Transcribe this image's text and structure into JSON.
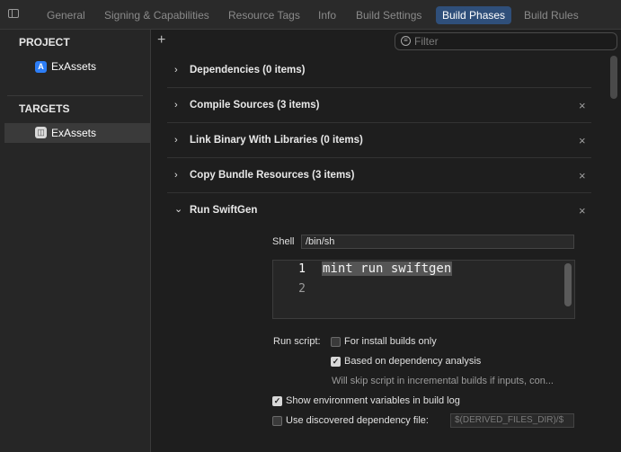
{
  "tabs": [
    {
      "label": "General"
    },
    {
      "label": "Signing & Capabilities"
    },
    {
      "label": "Resource Tags"
    },
    {
      "label": "Info"
    },
    {
      "label": "Build Settings"
    },
    {
      "label": "Build Phases",
      "active": true
    },
    {
      "label": "Build Rules"
    }
  ],
  "sidebar": {
    "project_title": "PROJECT",
    "project_item": "ExAssets",
    "targets_title": "TARGETS",
    "target_item": "ExAssets"
  },
  "toolbar": {
    "add_symbol": "+",
    "filter_placeholder": "Filter"
  },
  "phases": [
    {
      "title": "Dependencies (0 items)",
      "removable": false
    },
    {
      "title": "Compile Sources (3 items)",
      "removable": true
    },
    {
      "title": "Link Binary With Libraries (0 items)",
      "removable": true
    },
    {
      "title": "Copy Bundle Resources (3 items)",
      "removable": true
    },
    {
      "title": "Run SwiftGen",
      "removable": true,
      "expanded": true
    }
  ],
  "run_script": {
    "shell_label": "Shell",
    "shell_value": "/bin/sh",
    "line_numbers": [
      "1",
      "2"
    ],
    "code_line": "mint run swiftgen",
    "run_script_label": "Run script:",
    "install_builds_label": "For install builds only",
    "install_builds_checked": false,
    "dependency_analysis_label": "Based on dependency analysis",
    "dependency_analysis_checked": true,
    "dependency_hint": "Will skip script in incremental builds if inputs, con...",
    "show_env_label": "Show environment variables in build log",
    "show_env_checked": true,
    "discovered_dep_label": "Use discovered dependency file:",
    "discovered_dep_checked": false,
    "discovered_dep_placeholder": "$(DERIVED_FILES_DIR)/$"
  },
  "glyphs": {
    "chevron_right": "›",
    "chevron_down": "⌄",
    "close": "×",
    "check": "✓"
  },
  "colors": {
    "accent_tab": "#2f4f7a",
    "background": "#1e1e1e",
    "sidebar": "#262626"
  }
}
